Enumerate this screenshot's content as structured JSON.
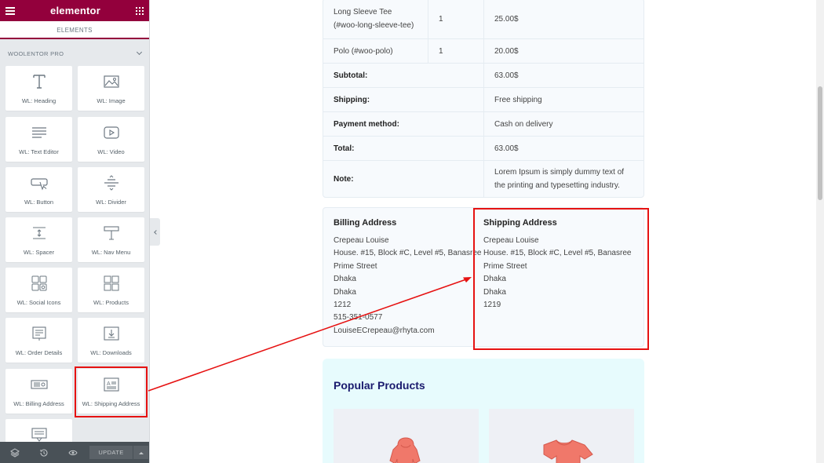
{
  "sidebar": {
    "logo": "elementor",
    "tab_label": "ELEMENTS",
    "section_title": "WOOLENTOR PRO",
    "widgets": [
      {
        "label": "WL: Heading",
        "icon": "heading-icon"
      },
      {
        "label": "WL: Image",
        "icon": "image-icon"
      },
      {
        "label": "WL: Text Editor",
        "icon": "text-editor-icon"
      },
      {
        "label": "WL: Video",
        "icon": "video-icon"
      },
      {
        "label": "WL: Button",
        "icon": "button-icon"
      },
      {
        "label": "WL: Divider",
        "icon": "divider-icon"
      },
      {
        "label": "WL: Spacer",
        "icon": "spacer-icon"
      },
      {
        "label": "WL: Nav Menu",
        "icon": "nav-menu-icon"
      },
      {
        "label": "WL: Social Icons",
        "icon": "social-icons-icon"
      },
      {
        "label": "WL: Products",
        "icon": "products-icon"
      },
      {
        "label": "WL: Order Details",
        "icon": "order-details-icon"
      },
      {
        "label": "WL: Downloads",
        "icon": "downloads-icon"
      },
      {
        "label": "WL: Billing Address",
        "icon": "billing-address-icon"
      },
      {
        "label": "WL: Shipping Address",
        "icon": "shipping-address-icon"
      },
      {
        "label": "",
        "icon": "comment-icon"
      }
    ],
    "footer": {
      "update_label": "UPDATE"
    }
  },
  "order": {
    "rows": [
      {
        "product": "Long Sleeve Tee (#woo-long-sleeve-tee)",
        "qty": "1",
        "price": "25.00$"
      },
      {
        "product": "Polo (#woo-polo)",
        "qty": "1",
        "price": "20.00$"
      }
    ],
    "totals": [
      {
        "label": "Subtotal:",
        "value": "63.00$"
      },
      {
        "label": "Shipping:",
        "value": "Free shipping"
      },
      {
        "label": "Payment method:",
        "value": "Cash on delivery"
      },
      {
        "label": "Total:",
        "value": "63.00$"
      },
      {
        "label": "Note:",
        "value": "Lorem Ipsum is simply dummy text of the printing and typesetting industry."
      }
    ]
  },
  "billing": {
    "title": "Billing Address",
    "lines": [
      "Crepeau Louise",
      "House. #15, Block #C, Level #5, Banasree",
      "Prime Street",
      "Dhaka",
      "Dhaka",
      "1212",
      "515-351-0577",
      "LouiseECrepeau@rhyta.com"
    ]
  },
  "shipping": {
    "title": "Shipping Address",
    "lines": [
      "Crepeau Louise",
      "House. #15, Block #C, Level #5, Banasree Prime Street",
      "Dhaka",
      "Dhaka",
      "1219"
    ]
  },
  "popular": {
    "title": "Popular Products"
  },
  "colors": {
    "brand": "#93003c",
    "highlight": "#e61212",
    "popular_bg": "#e7fbfd",
    "product_garment": "#f0786a"
  }
}
